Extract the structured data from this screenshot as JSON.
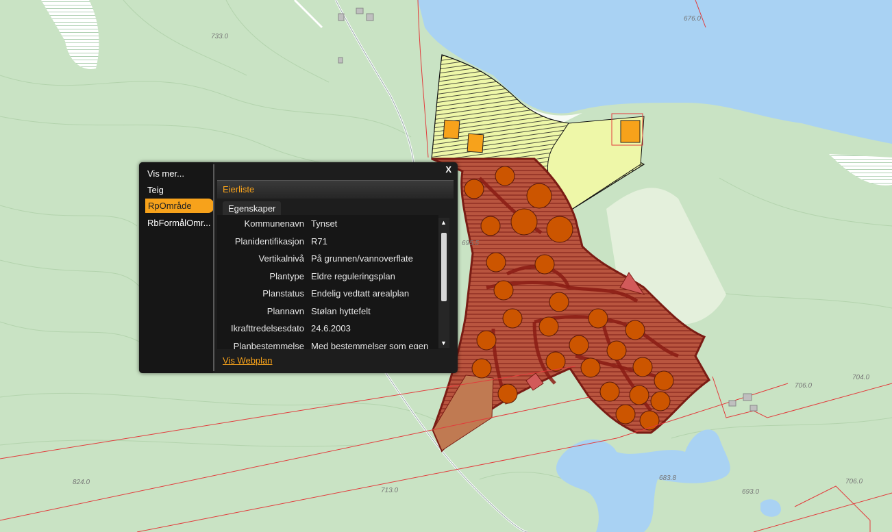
{
  "map": {
    "elevations": [
      "676.0",
      "733.0",
      "695.5",
      "706.0",
      "704.0",
      "824.0",
      "713.0",
      "683.8",
      "693.0",
      "706.0"
    ],
    "colors": {
      "land": "#c9e3c4",
      "water": "#a9d2f3",
      "plan_zone": "#b5533e",
      "lot": "#cc5500",
      "yellow_zone": "#eef7a8",
      "boundary": "#e23b3b"
    }
  },
  "popup": {
    "nav": {
      "title": "Vis mer...",
      "items": [
        "Teig",
        "RpOmråde",
        "RbFormålOmr..."
      ],
      "active_index": 1
    },
    "close_label": "X",
    "tab": "Eierliste",
    "subtab": "Egenskaper",
    "properties": [
      {
        "key": "Kommunenavn",
        "value": "Tynset"
      },
      {
        "key": "Planidentifikasjon",
        "value": "R71"
      },
      {
        "key": "Vertikalnivå",
        "value": "På grunnen/vannoverflate"
      },
      {
        "key": "Plantype",
        "value": "Eldre reguleringsplan"
      },
      {
        "key": "Planstatus",
        "value": "Endelig vedtatt arealplan"
      },
      {
        "key": "Plannavn",
        "value": "Stølan hyttefelt"
      },
      {
        "key": "Ikrafttredelsesdato",
        "value": "24.6.2003"
      },
      {
        "key": "Planbestemmelse",
        "value": "Med bestemmelser som egen"
      }
    ],
    "link": "Vis Webplan"
  }
}
